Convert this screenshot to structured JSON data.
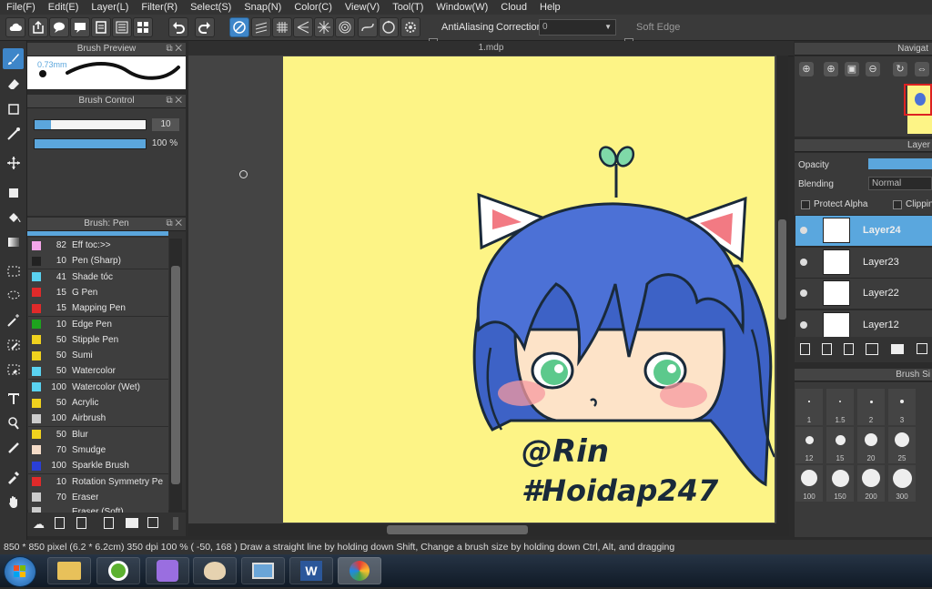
{
  "menu": [
    "File(F)",
    "Edit(E)",
    "Layer(L)",
    "Filter(R)",
    "Select(S)",
    "Snap(N)",
    "Color(C)",
    "View(V)",
    "Tool(T)",
    "Window(W)",
    "Cloud",
    "Help"
  ],
  "toolbar": {
    "antialiasing_label": "AntiAliasing",
    "correction_label": "Correction",
    "correction_value": "0",
    "soft_edge_label": "Soft Edge"
  },
  "brush_preview": {
    "title": "Brush Preview",
    "size_label": "0.73mm"
  },
  "brush_control": {
    "title": "Brush Control",
    "size_value": "10",
    "opacity_value": "100 %",
    "size_fraction": 0.15,
    "opacity_fraction": 1.0
  },
  "brush_list": {
    "title": "Brush: Pen",
    "items": [
      {
        "size": "82",
        "name": "Eff toc:>>",
        "color": "#f4a6e9"
      },
      {
        "size": "10",
        "name": "Pen (Sharp)",
        "color": "#222222"
      },
      {
        "size": "41",
        "name": "Shade tóc",
        "color": "#5ad2f0"
      },
      {
        "size": "15",
        "name": "G Pen",
        "color": "#e02a2a"
      },
      {
        "size": "15",
        "name": "Mapping Pen",
        "color": "#e02a2a"
      },
      {
        "size": "10",
        "name": "Edge Pen",
        "color": "#1ea31e"
      },
      {
        "size": "50",
        "name": "Stipple Pen",
        "color": "#f0d21e"
      },
      {
        "size": "50",
        "name": "Sumi",
        "color": "#f0d21e"
      },
      {
        "size": "50",
        "name": "Watercolor",
        "color": "#5ad2f0"
      },
      {
        "size": "100",
        "name": "Watercolor (Wet)",
        "color": "#5ad2f0"
      },
      {
        "size": "50",
        "name": "Acrylic",
        "color": "#f0d21e"
      },
      {
        "size": "100",
        "name": "Airbrush",
        "color": "#cccccc"
      },
      {
        "size": "50",
        "name": "Blur",
        "color": "#f0d21e"
      },
      {
        "size": "70",
        "name": "Smudge",
        "color": "#f5dcc8"
      },
      {
        "size": "100",
        "name": "Sparkle Brush",
        "color": "#2a3fd6"
      },
      {
        "size": "10",
        "name": "Rotation Symmetry Pe",
        "color": "#e02a2a"
      },
      {
        "size": "70",
        "name": "Eraser",
        "color": "#cccccc"
      },
      {
        "size": "",
        "name": "Eraser (Soft)",
        "color": "#cccccc"
      }
    ]
  },
  "document": {
    "tab": "1.mdp"
  },
  "artwork": {
    "line1": "@Rin",
    "line2": "#Hoidap247"
  },
  "navigator": {
    "title": "Navigat"
  },
  "layers": {
    "title": "Layer",
    "opacity_label": "Opacity",
    "blending_label": "Blending",
    "blending_value": "Normal",
    "protect_alpha_label": "Protect Alpha",
    "clipping_label": "Clipping",
    "items": [
      {
        "name": "Layer24",
        "selected": true
      },
      {
        "name": "Layer23",
        "selected": false
      },
      {
        "name": "Layer22",
        "selected": false
      },
      {
        "name": "Layer12",
        "selected": false
      }
    ]
  },
  "brush_size_panel": {
    "title": "Brush Si",
    "sizes": [
      "1",
      "1.5",
      "2",
      "3",
      "12",
      "15",
      "20",
      "25",
      "100",
      "150",
      "200",
      "300"
    ]
  },
  "status": {
    "text": "850 * 850 pixel   (6.2 * 6.2cm)   350 dpi   100 %   ( -50, 168 )   Draw a straight line by holding down Shift, Change a brush size by holding down Ctrl, Alt, and dragging"
  },
  "taskbar": {
    "apps": [
      "start-orb",
      "file-explorer",
      "coccoc-browser",
      "anime-avatar-app",
      "paint-app",
      "photo-viewer",
      "word",
      "medibang-paint"
    ]
  }
}
